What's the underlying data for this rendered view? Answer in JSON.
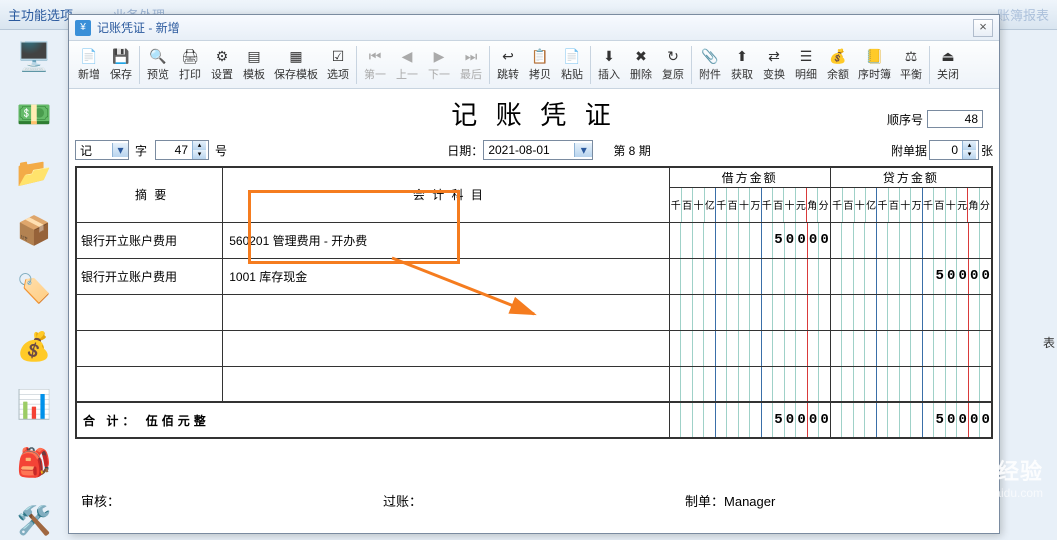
{
  "bg": {
    "menu_l": "主功能选项",
    "menu_m": "业务处理",
    "menu_r": "账簿报表",
    "side_text": "表"
  },
  "win": {
    "title": "记账凭证 - 新增"
  },
  "toolbar": [
    {
      "l": "新增",
      "ic": "📄",
      "i": true
    },
    {
      "l": "保存",
      "ic": "💾",
      "i": true
    },
    {
      "sep": true
    },
    {
      "l": "预览",
      "ic": "🔍",
      "i": true
    },
    {
      "l": "打印",
      "ic": "🖨",
      "i": true
    },
    {
      "l": "设置",
      "ic": "⚙",
      "i": true
    },
    {
      "l": "模板",
      "ic": "▤",
      "i": true
    },
    {
      "l": "保存模板",
      "ic": "▦",
      "i": true
    },
    {
      "l": "选项",
      "ic": "☑",
      "i": true
    },
    {
      "sep": true
    },
    {
      "l": "第一",
      "ic": "⏮",
      "i": false
    },
    {
      "l": "上一",
      "ic": "◀",
      "i": false
    },
    {
      "l": "下一",
      "ic": "▶",
      "i": false
    },
    {
      "l": "最后",
      "ic": "⏭",
      "i": false
    },
    {
      "sep": true
    },
    {
      "l": "跳转",
      "ic": "↩",
      "i": true
    },
    {
      "l": "拷贝",
      "ic": "📋",
      "i": true
    },
    {
      "l": "粘贴",
      "ic": "📄",
      "i": true
    },
    {
      "sep": true
    },
    {
      "l": "插入",
      "ic": "⬇",
      "i": true
    },
    {
      "l": "删除",
      "ic": "✖",
      "i": true
    },
    {
      "l": "复原",
      "ic": "↻",
      "i": true
    },
    {
      "sep": true
    },
    {
      "l": "附件",
      "ic": "📎",
      "i": true
    },
    {
      "l": "获取",
      "ic": "⬆",
      "i": true
    },
    {
      "l": "变换",
      "ic": "⇄",
      "i": true
    },
    {
      "l": "明细",
      "ic": "☰",
      "i": true
    },
    {
      "l": "余额",
      "ic": "💰",
      "i": true
    },
    {
      "l": "序时簿",
      "ic": "📒",
      "i": true
    },
    {
      "l": "平衡",
      "ic": "⚖",
      "i": true
    },
    {
      "sep": true
    },
    {
      "l": "关闭",
      "ic": "⏏",
      "i": true
    }
  ],
  "voucher": {
    "title": "记 账 凭 证",
    "seq_label": "顺序号",
    "seq_no": "48",
    "prefix": "记",
    "zi": "字",
    "num": "47",
    "hao": "号",
    "date_label": "日期：",
    "date": "2021-08-01",
    "period_l": "第",
    "period_n": "8",
    "period_r": "期",
    "attach_label": "附单据",
    "attach_n": "0",
    "zhang": "张",
    "col_summary": "摘    要",
    "col_account": "会 计 科 目",
    "col_debit": "借方金额",
    "col_credit": "贷方金额",
    "digit_hdrs": [
      "千",
      "百",
      "十",
      "亿",
      "千",
      "百",
      "十",
      "万",
      "千",
      "百",
      "十",
      "元",
      "角",
      "分"
    ],
    "rows": [
      {
        "summary": "银行开立账户费用",
        "account": "560201 管理费用 - 开办费",
        "debit": "50000",
        "credit": ""
      },
      {
        "summary": "银行开立账户费用",
        "account": "1001 库存现金",
        "debit": "",
        "credit": "50000"
      },
      {
        "summary": "",
        "account": "",
        "debit": "",
        "credit": ""
      },
      {
        "summary": "",
        "account": "",
        "debit": "",
        "credit": ""
      },
      {
        "summary": "",
        "account": "",
        "debit": "",
        "credit": ""
      }
    ],
    "total_label": "合   计：",
    "total_words": "伍佰元整",
    "total_debit": "50000",
    "total_credit": "50000",
    "audit": "审核：",
    "post": "过账：",
    "maker_l": "制单：",
    "maker": "Manager"
  },
  "watermark": {
    "big": "Baidu 经验",
    "sm": "jingyan.baidu.com"
  }
}
